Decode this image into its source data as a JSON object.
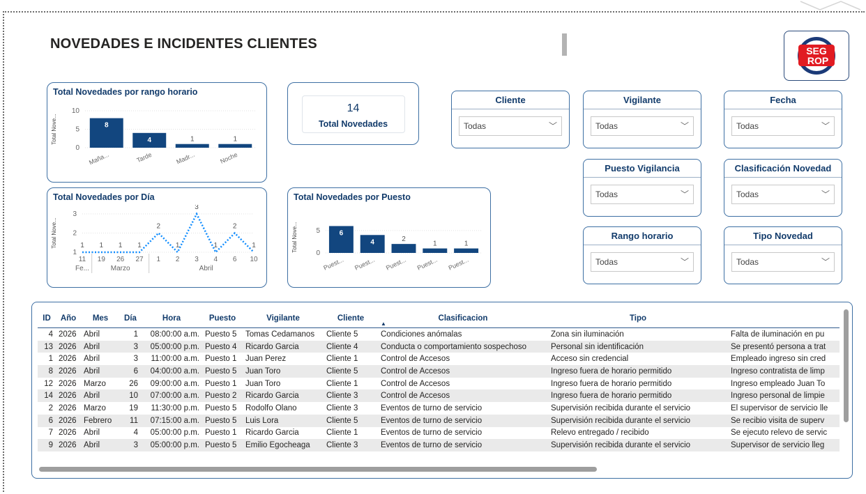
{
  "header": {
    "title": "NOVEDADES E INCIDENTES CLIENTES",
    "logo_line1": "SEG",
    "logo_line2": "ROP"
  },
  "kpi": {
    "value": "14",
    "label": "Total Novedades"
  },
  "slicers": [
    {
      "title": "Cliente",
      "value": "Todas"
    },
    {
      "title": "Vigilante",
      "value": "Todas"
    },
    {
      "title": "Fecha",
      "value": "Todas"
    },
    {
      "title": "Puesto Vigilancia",
      "value": "Todas"
    },
    {
      "title": "Clasificación Novedad",
      "value": "Todas"
    },
    {
      "title": "Rango horario",
      "value": "Todas"
    },
    {
      "title": "Tipo Novedad",
      "value": "Todas"
    }
  ],
  "chart_data": [
    {
      "type": "bar",
      "title": "Total Novedades por rango horario",
      "ylabel": "Total Nove...",
      "categories": [
        "Mañа...",
        "Tarde",
        "Madr...",
        "Noche"
      ],
      "values": [
        8,
        4,
        1,
        1
      ],
      "yticks": [
        0,
        5,
        10
      ],
      "ylim": [
        0,
        10
      ],
      "color": "#12467f"
    },
    {
      "type": "line",
      "title": "Total Novedades por Día",
      "ylabel": "Total Nove...",
      "x": [
        "11",
        "19",
        "26",
        "27",
        "1",
        "2",
        "3",
        "4",
        "6",
        "10"
      ],
      "values": [
        1,
        1,
        1,
        1,
        2,
        1,
        3,
        1,
        2,
        1
      ],
      "groups": [
        "Fe...",
        "Marzo",
        "Abril"
      ],
      "yticks": [
        1,
        2,
        3
      ],
      "ylim": [
        1,
        3
      ],
      "color": "#118dff"
    },
    {
      "type": "bar",
      "title": "Total Novedades por Puesto",
      "ylabel": "Total Nove...",
      "categories": [
        "Puest...",
        "Puest...",
        "Puest...",
        "Puest...",
        "Puest..."
      ],
      "values": [
        6,
        4,
        2,
        1,
        1
      ],
      "yticks": [
        0,
        5
      ],
      "ylim": [
        0,
        7
      ],
      "color": "#12467f"
    }
  ],
  "table": {
    "columns": [
      "ID",
      "Año",
      "Mes",
      "Día",
      "Hora",
      "Puesto",
      "Vigilante",
      "Cliente",
      "Clasificacion",
      "Tipo",
      ""
    ],
    "rows": [
      [
        "4",
        "2026",
        "Abril",
        "1",
        "08:00:00 a.m.",
        "Puesto 5",
        "Tomas Cedamanos",
        "Cliente 5",
        "Condiciones anómalas",
        "Zona sin iluminación",
        "Falta de iluminación en pu"
      ],
      [
        "13",
        "2026",
        "Abril",
        "3",
        "05:00:00 p.m.",
        "Puesto 4",
        "Ricardo Garcia",
        "Cliente 4",
        "Conducta o comportamiento sospechoso",
        "Personal sin identificación",
        "Se presentó persona a trat"
      ],
      [
        "1",
        "2026",
        "Abril",
        "3",
        "11:00:00 a.m.",
        "Puesto 1",
        "Juan Perez",
        "Cliente 1",
        "Control de Accesos",
        "Acceso sin credencial",
        "Empleado ingreso sin cred"
      ],
      [
        "8",
        "2026",
        "Abril",
        "6",
        "04:00:00 a.m.",
        "Puesto 5",
        "Juan Toro",
        "Cliente 5",
        "Control de Accesos",
        "Ingreso fuera de horario permitido",
        "Ingreso contratista de limp"
      ],
      [
        "12",
        "2026",
        "Marzo",
        "26",
        "09:00:00 a.m.",
        "Puesto 1",
        "Juan Toro",
        "Cliente 1",
        "Control de Accesos",
        "Ingreso fuera de horario permitido",
        "Ingreso empleado Juan To"
      ],
      [
        "14",
        "2026",
        "Abril",
        "10",
        "07:00:00 a.m.",
        "Puesto 2",
        "Ricardo Garcia",
        "Cliente 3",
        "Control de Accesos",
        "Ingreso fuera de horario permitido",
        "Ingreso personal de limpie"
      ],
      [
        "2",
        "2026",
        "Marzo",
        "19",
        "11:30:00 p.m.",
        "Puesto 5",
        "Rodolfo Olano",
        "Cliente 3",
        "Eventos de turno de servicio",
        "Supervisión recibida durante el servicio",
        "El supervisor de servicio lle"
      ],
      [
        "6",
        "2026",
        "Febrero",
        "11",
        "07:15:00 a.m.",
        "Puesto 5",
        "Luis Lora",
        "Cliente 5",
        "Eventos de turno de servicio",
        "Supervisión recibida durante el servicio",
        "Se recibio visita de superv"
      ],
      [
        "7",
        "2026",
        "Abril",
        "4",
        "05:00:00 p.m.",
        "Puesto 1",
        "Ricardo Garcia",
        "Cliente 1",
        "Eventos de turno de servicio",
        "Relevo entregado / recibido",
        "Se ejecuto relevo de servic"
      ],
      [
        "9",
        "2026",
        "Abril",
        "3",
        "05:00:00 p.m.",
        "Puesto 5",
        "Emilio Egocheaga",
        "Cliente 3",
        "Eventos de turno de servicio",
        "Supervisión recibida durante el servicio",
        "Supervisor de servicio lleg"
      ]
    ]
  }
}
